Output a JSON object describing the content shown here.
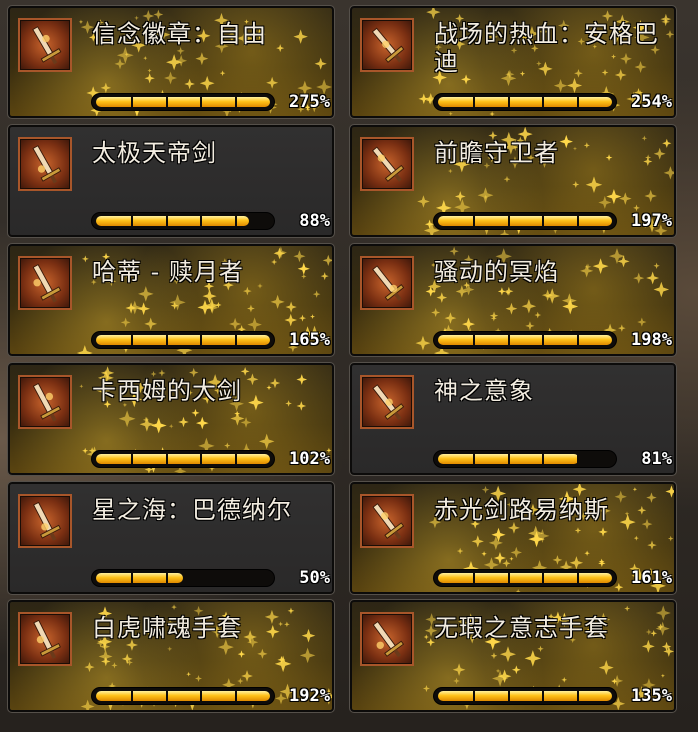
{
  "items": [
    {
      "name": "信念徽章：自由",
      "progress_label": "275%",
      "progress": 1.0,
      "style": "gold",
      "icon": "badge-icon"
    },
    {
      "name": "战场的热血：安格巴迪",
      "progress_label": "254%",
      "progress": 1.0,
      "style": "gold",
      "icon": "spear-icon"
    },
    {
      "name": "太极天帝剑",
      "progress_label": "88%",
      "progress": 0.88,
      "style": "plain",
      "icon": "sword-icon"
    },
    {
      "name": "前瞻守卫者",
      "progress_label": "197%",
      "progress": 1.0,
      "style": "gold",
      "icon": "lance-icon"
    },
    {
      "name": "哈蒂 - 赎月者",
      "progress_label": "165%",
      "progress": 1.0,
      "style": "gold",
      "icon": "axe-icon"
    },
    {
      "name": "骚动的冥焰",
      "progress_label": "198%",
      "progress": 1.0,
      "style": "gold",
      "icon": "flame-blade-icon"
    },
    {
      "name": "卡西姆的大剑",
      "progress_label": "102%",
      "progress": 1.0,
      "style": "gold",
      "icon": "greatsword-icon"
    },
    {
      "name": "神之意象",
      "progress_label": "81%",
      "progress": 0.81,
      "style": "plain",
      "icon": "divine-blade-icon"
    },
    {
      "name": "星之海：巴德纳尔",
      "progress_label": "50%",
      "progress": 0.5,
      "style": "plain",
      "icon": "staff-icon"
    },
    {
      "name": "赤光剑路易纳斯",
      "progress_label": "161%",
      "progress": 1.0,
      "style": "gold",
      "icon": "red-sword-icon"
    },
    {
      "name": "白虎啸魂手套",
      "progress_label": "192%",
      "progress": 1.0,
      "style": "gold",
      "icon": "gauntlet-icon"
    },
    {
      "name": "无瑕之意志手套",
      "progress_label": "135%",
      "progress": 1.0,
      "style": "gold",
      "icon": "glove-icon"
    }
  ],
  "colors": {
    "gold_fill": "#ffc21a",
    "card_gold_bg": "#3a2e10",
    "card_plain_bg": "#2c2b2a",
    "icon_frame": "#a8562a"
  }
}
